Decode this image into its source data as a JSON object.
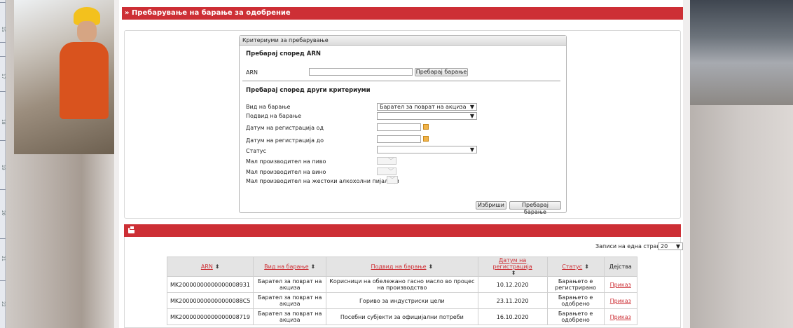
{
  "page": {
    "title": "» Пребарување на барање за одобрение"
  },
  "criteria": {
    "header": "Критериуми за пребарување",
    "arn_section": "Пребарај според ARN",
    "arn_label": "ARN",
    "arn_value": "",
    "arn_search_button": "Пребарај барање",
    "other_section": "Пребарај според други критериуми",
    "fields": {
      "request_type_label": "Вид на барање",
      "request_type_value": "Барател за поврат на акциза",
      "request_subtype_label": "Подвид на барање",
      "request_subtype_value": "",
      "reg_date_from_label": "Датум на регистрација од",
      "reg_date_to_label": "Датум на регистрација до",
      "status_label": "Статус",
      "status_value": "",
      "small_beer_label": "Мал производител на пиво",
      "small_wine_label": "Мал производител на вино",
      "small_spirits_label": "Мал производител на жестоки алкохолни пијалаци"
    },
    "clear_button": "Избриши",
    "search_button": "Пребарај барање"
  },
  "results": {
    "records_per_page_label": "Записи на една страна:",
    "records_per_page_value": "20",
    "columns": [
      {
        "label": "ARN",
        "sortable": true
      },
      {
        "label": "Вид на барање",
        "sortable": true
      },
      {
        "label": "Подвид на барање",
        "sortable": true
      },
      {
        "label": "Датум на регистрација",
        "sortable": true
      },
      {
        "label": "Статус",
        "sortable": true
      },
      {
        "label": "Дејства",
        "sortable": false
      }
    ],
    "rows": [
      {
        "arn": "MK20000000000000008931",
        "type": "Барател за поврат на акциза",
        "subtype": "Корисници на обележано гасно масло во процес на производство",
        "date": "10.12.2020",
        "status": "Барањето е регистрирано",
        "action": "Приказ"
      },
      {
        "arn": "MK200000000000000088C5",
        "type": "Барател за поврат на акциза",
        "subtype": "Гориво за индустриски цели",
        "date": "23.11.2020",
        "status": "Барањето е одобрено",
        "action": "Приказ"
      },
      {
        "arn": "MK20000000000000008719",
        "type": "Барател за поврат на акциза",
        "subtype": "Посебни субјекти за официјални потреби",
        "date": "16.10.2020",
        "status": "Барањето е одобрено",
        "action": "Приказ"
      }
    ]
  },
  "ruler": {
    "labels": [
      "15",
      "17",
      "18",
      "19",
      "20",
      "21",
      "22"
    ]
  },
  "colors": {
    "accent": "#cd2f35",
    "header_bg": "#e4e4e4"
  },
  "icons": {
    "print": "printer-icon",
    "calendar": "calendar-icon",
    "dropdown": "chevron-down-icon",
    "sort": "sort-arrows-icon"
  }
}
